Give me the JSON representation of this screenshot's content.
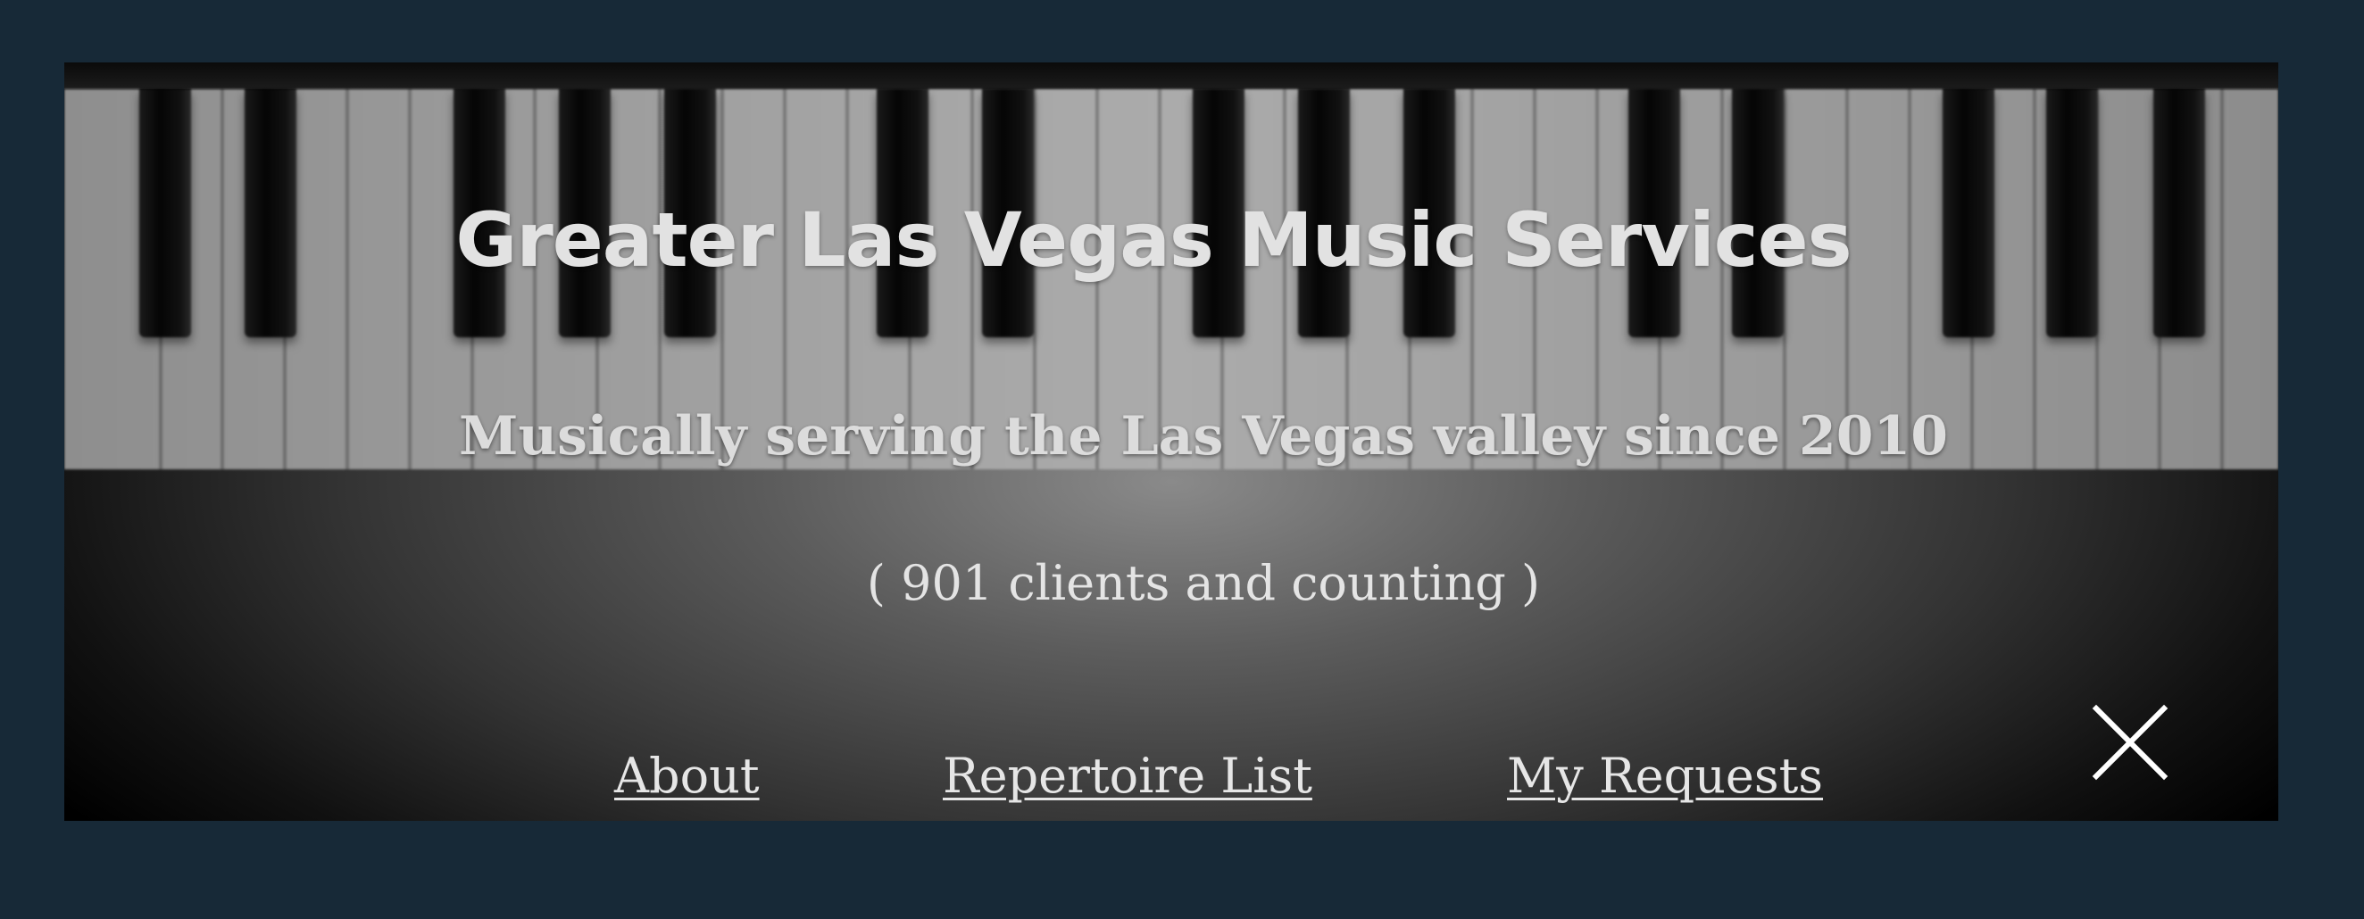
{
  "site": {
    "title": "Greater Las Vegas Music Services",
    "tagline": "Musically serving the Las Vegas valley since 2010",
    "client_count": "( 901 clients and counting )"
  },
  "nav": {
    "items": [
      {
        "label": "About"
      },
      {
        "label": "Repertoire List"
      },
      {
        "label": "My Requests"
      }
    ]
  },
  "icons": {
    "close": "close-icon"
  },
  "colors": {
    "page_background": "#172937",
    "text": "#e2e2e2"
  }
}
